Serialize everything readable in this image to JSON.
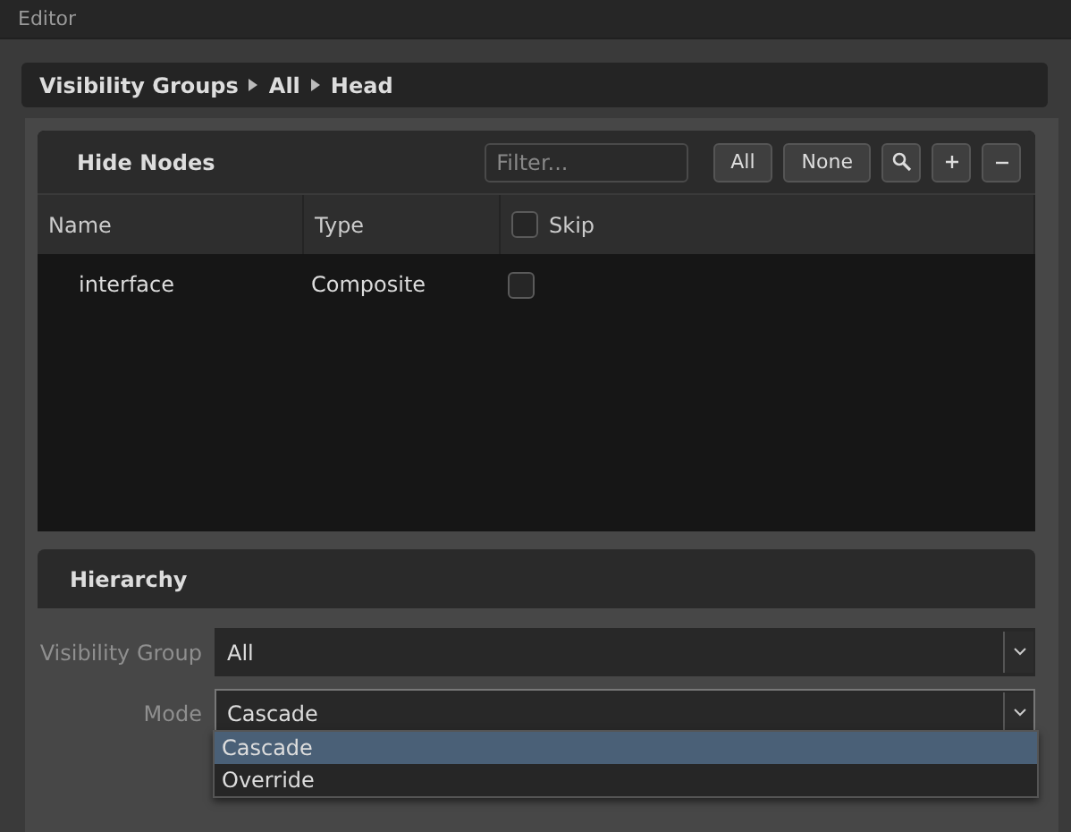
{
  "window": {
    "title": "Editor"
  },
  "breadcrumb": [
    "Visibility Groups",
    "All",
    "Head"
  ],
  "hide_nodes": {
    "title": "Hide Nodes",
    "filter": {
      "placeholder": "Filter..."
    },
    "buttons": [
      "All",
      "None"
    ],
    "columns": [
      {
        "label": "Name"
      },
      {
        "label": "Type"
      },
      {
        "label": "Skip",
        "checked": false
      }
    ],
    "rows": [
      {
        "name": "interface",
        "type": "Composite",
        "skip": false
      }
    ]
  },
  "hierarchy": {
    "title": "Hierarchy",
    "fields": [
      {
        "label": "Visibility Group",
        "value": "All",
        "focused": false
      },
      {
        "label": "Mode",
        "value": "Cascade",
        "focused": true
      }
    ],
    "dropdown": {
      "options": [
        {
          "label": "Cascade",
          "selected": true
        },
        {
          "label": "Override",
          "selected": false
        }
      ]
    }
  }
}
